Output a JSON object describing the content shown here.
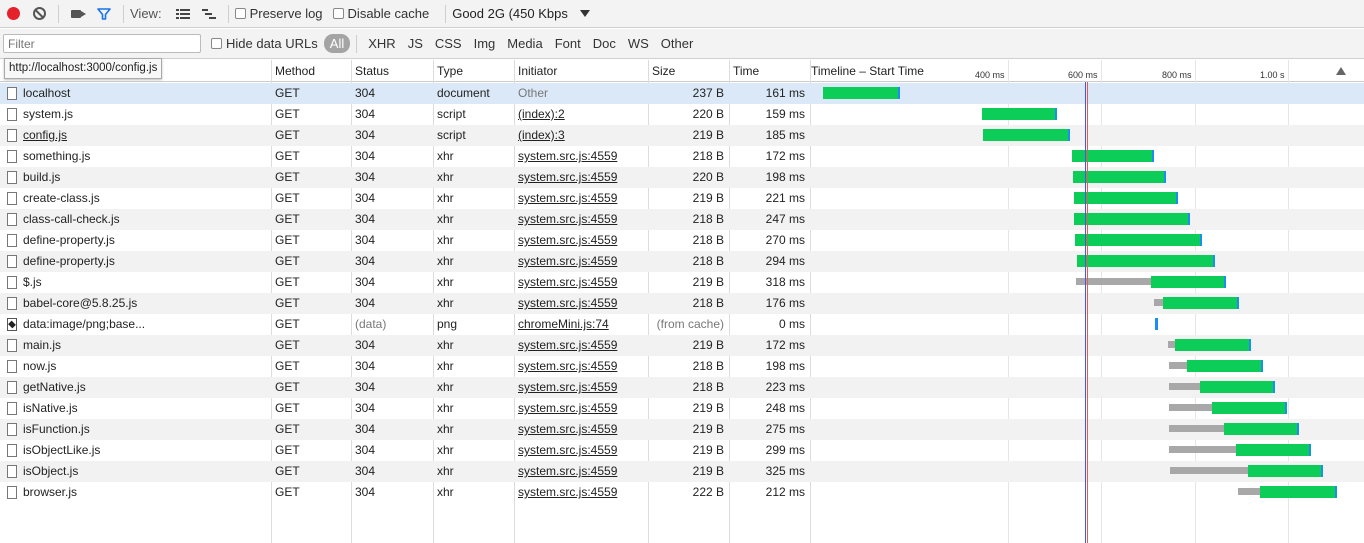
{
  "toolbar": {
    "view_label": "View:",
    "preserve_log": "Preserve log",
    "disable_cache": "Disable cache",
    "throttle": "Good 2G (450 Kbps"
  },
  "filterbar": {
    "placeholder": "Filter",
    "hide_data_urls": "Hide data URLs",
    "types": [
      "All",
      "XHR",
      "JS",
      "CSS",
      "Img",
      "Media",
      "Font",
      "Doc",
      "WS",
      "Other"
    ]
  },
  "tooltip": "http://localhost:3000/config.js",
  "columns": {
    "method": "Method",
    "status": "Status",
    "type": "Type",
    "initiator": "Initiator",
    "size": "Size",
    "time": "Time",
    "timeline": "Timeline – Start Time"
  },
  "timeline_ticks": [
    "400 ms",
    "600 ms",
    "800 ms",
    "1.00 s"
  ],
  "rows": [
    {
      "name": "localhost",
      "method": "GET",
      "status": "304",
      "type": "document",
      "initiator": "Other",
      "size": "237 B",
      "time": "161 ms"
    },
    {
      "name": "system.js",
      "method": "GET",
      "status": "304",
      "type": "script",
      "initiator": "(index):2",
      "size": "220 B",
      "time": "159 ms"
    },
    {
      "name": "config.js",
      "method": "GET",
      "status": "304",
      "type": "script",
      "initiator": "(index):3",
      "size": "219 B",
      "time": "185 ms"
    },
    {
      "name": "something.js",
      "method": "GET",
      "status": "304",
      "type": "xhr",
      "initiator": "system.src.js:4559",
      "size": "218 B",
      "time": "172 ms"
    },
    {
      "name": "build.js",
      "method": "GET",
      "status": "304",
      "type": "xhr",
      "initiator": "system.src.js:4559",
      "size": "220 B",
      "time": "198 ms"
    },
    {
      "name": "create-class.js",
      "method": "GET",
      "status": "304",
      "type": "xhr",
      "initiator": "system.src.js:4559",
      "size": "219 B",
      "time": "221 ms"
    },
    {
      "name": "class-call-check.js",
      "method": "GET",
      "status": "304",
      "type": "xhr",
      "initiator": "system.src.js:4559",
      "size": "218 B",
      "time": "247 ms"
    },
    {
      "name": "define-property.js",
      "method": "GET",
      "status": "304",
      "type": "xhr",
      "initiator": "system.src.js:4559",
      "size": "218 B",
      "time": "270 ms"
    },
    {
      "name": "define-property.js",
      "method": "GET",
      "status": "304",
      "type": "xhr",
      "initiator": "system.src.js:4559",
      "size": "218 B",
      "time": "294 ms"
    },
    {
      "name": "$.js",
      "method": "GET",
      "status": "304",
      "type": "xhr",
      "initiator": "system.src.js:4559",
      "size": "219 B",
      "time": "318 ms"
    },
    {
      "name": "babel-core@5.8.25.js",
      "method": "GET",
      "status": "304",
      "type": "xhr",
      "initiator": "system.src.js:4559",
      "size": "218 B",
      "time": "176 ms"
    },
    {
      "name": "data:image/png;base...",
      "method": "GET",
      "status": "(data)",
      "type": "png",
      "initiator": "chromeMini.js:74",
      "size": "(from cache)",
      "time": "0 ms"
    },
    {
      "name": "main.js",
      "method": "GET",
      "status": "304",
      "type": "xhr",
      "initiator": "system.src.js:4559",
      "size": "219 B",
      "time": "172 ms"
    },
    {
      "name": "now.js",
      "method": "GET",
      "status": "304",
      "type": "xhr",
      "initiator": "system.src.js:4559",
      "size": "218 B",
      "time": "198 ms"
    },
    {
      "name": "getNative.js",
      "method": "GET",
      "status": "304",
      "type": "xhr",
      "initiator": "system.src.js:4559",
      "size": "218 B",
      "time": "223 ms"
    },
    {
      "name": "isNative.js",
      "method": "GET",
      "status": "304",
      "type": "xhr",
      "initiator": "system.src.js:4559",
      "size": "219 B",
      "time": "248 ms"
    },
    {
      "name": "isFunction.js",
      "method": "GET",
      "status": "304",
      "type": "xhr",
      "initiator": "system.src.js:4559",
      "size": "219 B",
      "time": "275 ms"
    },
    {
      "name": "isObjectLike.js",
      "method": "GET",
      "status": "304",
      "type": "xhr",
      "initiator": "system.src.js:4559",
      "size": "219 B",
      "time": "299 ms"
    },
    {
      "name": "isObject.js",
      "method": "GET",
      "status": "304",
      "type": "xhr",
      "initiator": "system.src.js:4559",
      "size": "219 B",
      "time": "325 ms"
    },
    {
      "name": "browser.js",
      "method": "GET",
      "status": "304",
      "type": "xhr",
      "initiator": "system.src.js:4559",
      "size": "222 B",
      "time": "212 ms"
    }
  ]
}
